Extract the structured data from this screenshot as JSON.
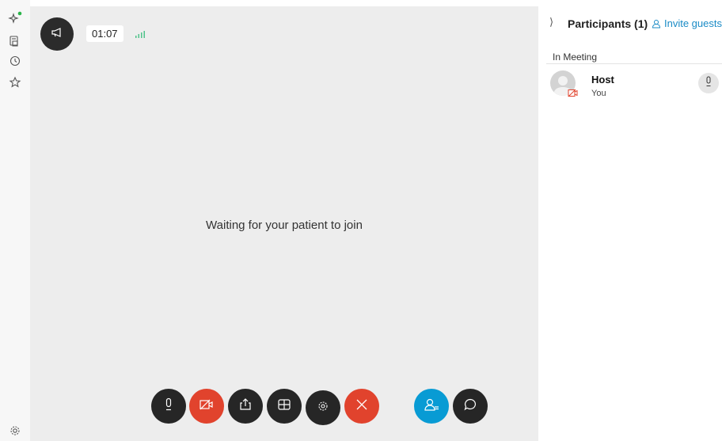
{
  "rail": {
    "icons": [
      "sparkle-icon",
      "phone-contacts-icon",
      "clock-icon",
      "star-icon",
      "gear-icon"
    ],
    "status_color": "#2ab54a"
  },
  "stage": {
    "timer": "01:07",
    "waiting_message": "Waiting for your patient to join"
  },
  "controls": [
    {
      "name": "mic-button",
      "icon": "mic-icon",
      "color": "#262626"
    },
    {
      "name": "video-off-button",
      "icon": "video-off-icon",
      "color": "#e1432d"
    },
    {
      "name": "share-button",
      "icon": "share-icon",
      "color": "#262626"
    },
    {
      "name": "layout-button",
      "icon": "grid-icon",
      "color": "#262626"
    },
    {
      "name": "settings-button",
      "icon": "gear-icon",
      "color": "#262626"
    },
    {
      "name": "end-call-button",
      "icon": "close-icon",
      "color": "#e1432d"
    },
    {
      "name": "participants-button",
      "icon": "participants-icon",
      "color": "#089bd4"
    },
    {
      "name": "chat-button",
      "icon": "chat-icon",
      "color": "#262626"
    }
  ],
  "panel": {
    "title": "Participants (1)",
    "invite_label": "Invite guests",
    "section": "In Meeting",
    "participant": {
      "name": "Host",
      "subtitle": "You"
    }
  }
}
